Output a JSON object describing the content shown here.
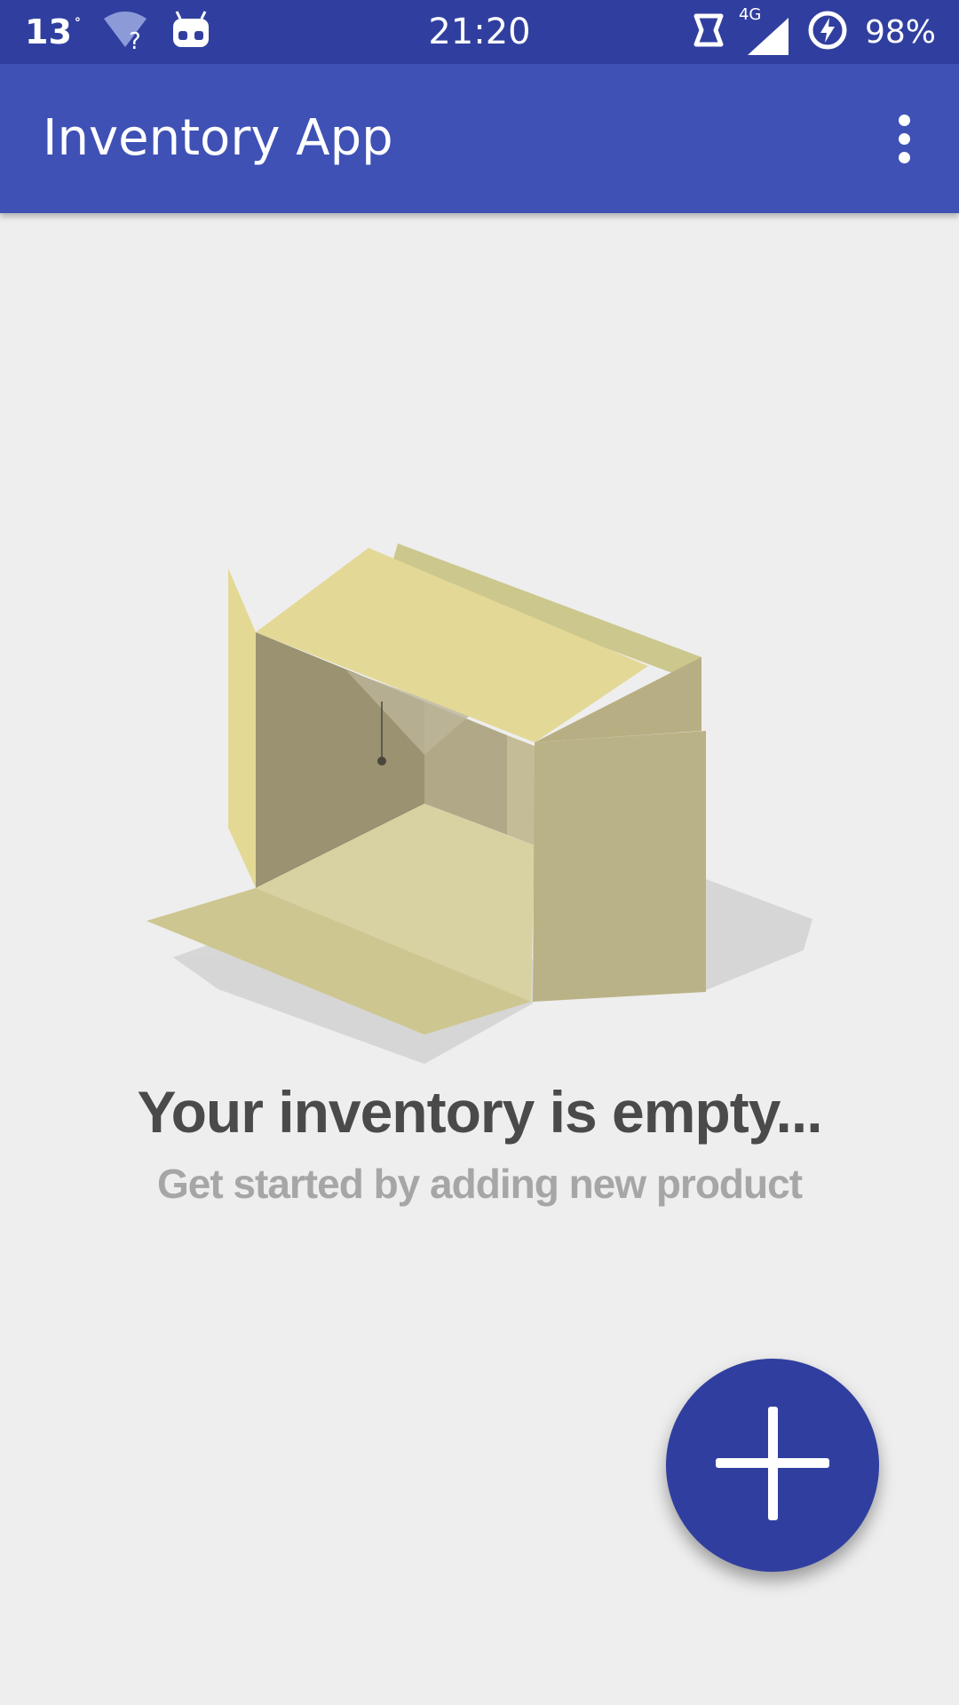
{
  "status_bar": {
    "temperature": "13",
    "temperature_unit": "°",
    "time": "21:20",
    "network_type": "4G",
    "battery_percent": "98%",
    "icons": [
      "wifi-unknown-icon",
      "android-robot-icon",
      "nfc-icon",
      "signal-icon",
      "battery-charging-icon"
    ]
  },
  "app_bar": {
    "title": "Inventory App",
    "overflow_icon": "more-vert-icon"
  },
  "empty_state": {
    "illustration": "open-empty-box-icon",
    "title": "Your inventory is empty...",
    "subtitle": "Get started by adding new product"
  },
  "fab": {
    "icon": "plus-icon"
  },
  "colors": {
    "status_bar": "#303f9f",
    "app_bar": "#3f51b5",
    "fab": "#303f9f",
    "background": "#eeeeee"
  }
}
